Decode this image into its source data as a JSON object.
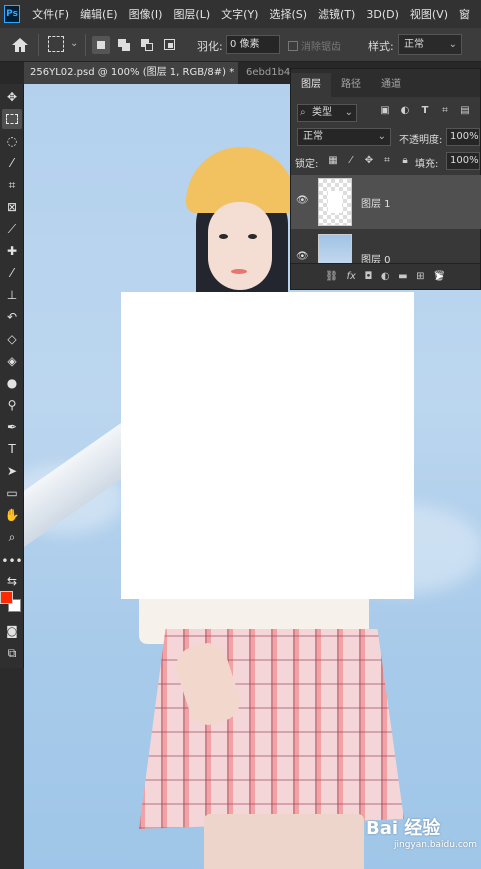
{
  "app": {
    "logo": "Ps"
  },
  "menu": [
    "文件(F)",
    "编辑(E)",
    "图像(I)",
    "图层(L)",
    "文字(Y)",
    "选择(S)",
    "滤镜(T)",
    "3D(D)",
    "视图(V)",
    "窗"
  ],
  "options": {
    "feather_label": "羽化:",
    "feather_value": "0 像素",
    "antialias_label": "消除锯齿",
    "style_label": "样式:",
    "style_value": "正常"
  },
  "tabs": {
    "active": "256YL02.psd @ 100% (图层 1, RGB/8#) *",
    "active_close": "×",
    "inactive": "6ebd1b4"
  },
  "layers_panel": {
    "tabs": [
      "图层",
      "路径",
      "通道"
    ],
    "filter_value": "类型",
    "blend_value": "正常",
    "opacity_label": "不透明度:",
    "opacity_value": "100%",
    "lock_label": "锁定:",
    "fill_label": "填充:",
    "fill_value": "100%",
    "layers": [
      {
        "name": "图层 1",
        "selected": true
      },
      {
        "name": "图层 0",
        "selected": false
      }
    ]
  },
  "colors": {
    "foreground": "#ff2a00",
    "background": "#ffffff",
    "ps_blue": "#31a8ff"
  },
  "watermark": {
    "logo": "Bai 经验",
    "url": "jingyan.baidu.com"
  }
}
